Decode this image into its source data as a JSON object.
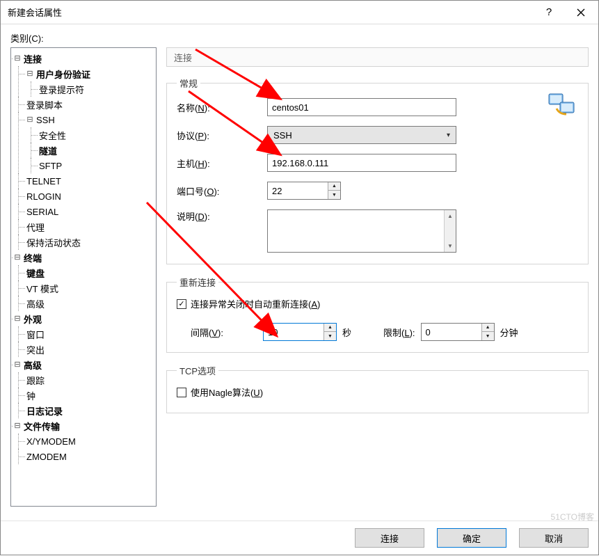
{
  "dialog": {
    "title": "新建会话属性"
  },
  "category_label": "类别(C):",
  "tree": {
    "connection": {
      "label": "连接",
      "user_auth": "用户身份验证",
      "login_prompt": "登录提示符",
      "login_script": "登录脚本",
      "ssh": {
        "label": "SSH",
        "security": "安全性",
        "tunnel": "隧道",
        "sftp": "SFTP"
      },
      "telnet": "TELNET",
      "rlogin": "RLOGIN",
      "serial": "SERIAL",
      "proxy": "代理",
      "keepalive": "保持活动状态"
    },
    "terminal": {
      "label": "终端",
      "keyboard": "键盘",
      "vt_mode": "VT 模式",
      "advanced": "高级"
    },
    "appearance": {
      "label": "外观",
      "window": "窗口",
      "highlight": "突出"
    },
    "advanced": {
      "label": "高级",
      "trace": "跟踪",
      "bell": "钟",
      "logging": "日志记录"
    },
    "filetransfer": {
      "label": "文件传输",
      "xymodem": "X/YMODEM",
      "zmodem": "ZMODEM"
    }
  },
  "tab_label": "连接",
  "general": {
    "legend": "常规",
    "name_label": "名称(N):",
    "name_value": "centos01",
    "protocol_label": "协议(P):",
    "protocol_value": "SSH",
    "host_label": "主机(H):",
    "host_value": "192.168.0.111",
    "port_label": "端口号(O):",
    "port_value": "22",
    "desc_label": "说明(D):"
  },
  "reconnect": {
    "legend": "重新连接",
    "auto_label": "连接异常关闭时自动重新连接(A)",
    "interval_label": "间隔(V):",
    "interval_value": "10",
    "interval_unit": "秒",
    "limit_label": "限制(L):",
    "limit_value": "0",
    "limit_unit": "分钟"
  },
  "tcp": {
    "legend": "TCP选项",
    "nagle_label": "使用Nagle算法(U)"
  },
  "buttons": {
    "connect": "连接",
    "ok": "确定",
    "cancel": "取消"
  },
  "watermark": "51CTO博客"
}
